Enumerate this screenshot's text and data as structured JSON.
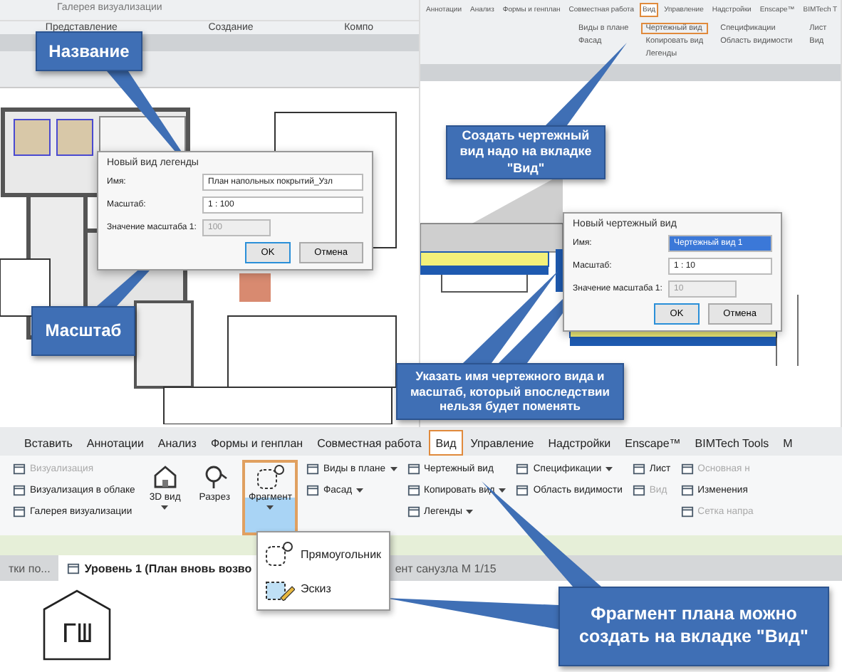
{
  "top_left": {
    "ribbon_item": "Галерея визуализации",
    "panels": [
      "Представление",
      "Создание",
      "Компо"
    ],
    "dialog": {
      "title": "Новый вид легенды",
      "name_label": "Имя:",
      "name_value": "План напольных покрытий_Узл",
      "name_selected": false,
      "scale_label": "Масштаб:",
      "scale_value": "1 : 100",
      "number_label": "Значение масштаба 1:",
      "number_value": "100",
      "ok": "OK",
      "cancel": "Отмена"
    }
  },
  "top_right": {
    "tabs": [
      {
        "label": "Аннотации",
        "selected": false
      },
      {
        "label": "Анализ",
        "selected": false
      },
      {
        "label": "Формы и генплан",
        "selected": false
      },
      {
        "label": "Совместная работа",
        "selected": false
      },
      {
        "label": "Вид",
        "selected": true
      },
      {
        "label": "Управление",
        "selected": false
      },
      {
        "label": "Надстройки",
        "selected": false
      },
      {
        "label": "Enscape™",
        "selected": false
      },
      {
        "label": "BIMTech T",
        "selected": false
      }
    ],
    "columns": [
      [
        {
          "label": "Виды в плане",
          "highlighted": false
        },
        {
          "label": "Фасад",
          "highlighted": false
        }
      ],
      [
        {
          "label": "Чертежный вид",
          "highlighted": true
        },
        {
          "label": "Копировать вид",
          "highlighted": false
        },
        {
          "label": "Легенды",
          "highlighted": false
        }
      ],
      [
        {
          "label": "Спецификации",
          "highlighted": false
        },
        {
          "label": "Область видимости",
          "highlighted": false
        }
      ],
      [
        {
          "label": "Лист",
          "highlighted": false
        },
        {
          "label": "Вид",
          "highlighted": false
        }
      ]
    ],
    "dialog": {
      "title": "Новый чертежный вид",
      "name_label": "Имя:",
      "name_value": "Чертежный вид 1",
      "name_selected": true,
      "scale_label": "Масштаб:",
      "scale_value": "1 : 10",
      "number_label": "Значение масштаба 1:",
      "number_value": "10",
      "ok": "OK",
      "cancel": "Отмена"
    }
  },
  "bottom": {
    "tabs": [
      {
        "label": "Вставить",
        "selected": false
      },
      {
        "label": "Аннотации",
        "selected": false
      },
      {
        "label": "Анализ",
        "selected": false
      },
      {
        "label": "Формы и генплан",
        "selected": false
      },
      {
        "label": "Совместная работа",
        "selected": false
      },
      {
        "label": "Вид",
        "selected": true
      },
      {
        "label": "Управление",
        "selected": false
      },
      {
        "label": "Надстройки",
        "selected": false
      },
      {
        "label": "Enscape™",
        "selected": false
      },
      {
        "label": "BIMTech Tools",
        "selected": false
      },
      {
        "label": "M",
        "selected": false
      }
    ],
    "render_items": [
      {
        "label": "Визуализация",
        "disabled": true
      },
      {
        "label": "Визуализация в облаке",
        "disabled": false
      },
      {
        "label": "Галерея визуализации",
        "disabled": false
      }
    ],
    "big_buttons": [
      {
        "label": "3D вид",
        "kind": "house",
        "highlighted": false,
        "has_menu": true
      },
      {
        "label": "Разрез",
        "kind": "section",
        "highlighted": false,
        "has_menu": false
      },
      {
        "label": "Фрагмент",
        "kind": "callout",
        "highlighted": true,
        "has_menu": true
      }
    ],
    "columns": [
      [
        {
          "label": "Виды в плане",
          "disabled": false,
          "has_menu": true
        },
        {
          "label": "Фасад",
          "disabled": false,
          "has_menu": true
        }
      ],
      [
        {
          "label": "Чертежный вид",
          "disabled": false,
          "has_menu": false
        },
        {
          "label": "Копировать вид",
          "disabled": false,
          "has_menu": true
        },
        {
          "label": "Легенды",
          "disabled": false,
          "has_menu": true
        }
      ],
      [
        {
          "label": "Спецификации",
          "disabled": false,
          "has_menu": true
        },
        {
          "label": "Область видимости",
          "disabled": false,
          "has_menu": false
        }
      ],
      [
        {
          "label": "Лист",
          "disabled": false,
          "has_menu": false
        },
        {
          "label": "Вид",
          "disabled": true,
          "has_menu": false
        }
      ],
      [
        {
          "label": "Основная н",
          "disabled": true,
          "has_menu": false
        },
        {
          "label": "Изменения",
          "disabled": false,
          "has_menu": false
        },
        {
          "label": "Сетка напра",
          "disabled": true,
          "has_menu": false
        }
      ]
    ],
    "menu": [
      "Прямоугольник",
      "Эскиз"
    ],
    "view_tabs": [
      {
        "label": "тки по...",
        "selected": false
      },
      {
        "label": "Уровень 1 (План вновь возво",
        "selected": true
      },
      {
        "label": "ент санузла М 1/15",
        "selected": false
      }
    ],
    "tag": "ГШ"
  },
  "callouts": [
    {
      "text": "Название"
    },
    {
      "text": "Масштаб"
    },
    {
      "text": "Создать чертежный вид надо на вкладке \"Вид\""
    },
    {
      "text": "Указать имя чертежного вида и масштаб, который впоследствии нельзя будет поменять"
    },
    {
      "text": "Фрагмент плана можно создать на вкладке \"Вид\""
    }
  ]
}
